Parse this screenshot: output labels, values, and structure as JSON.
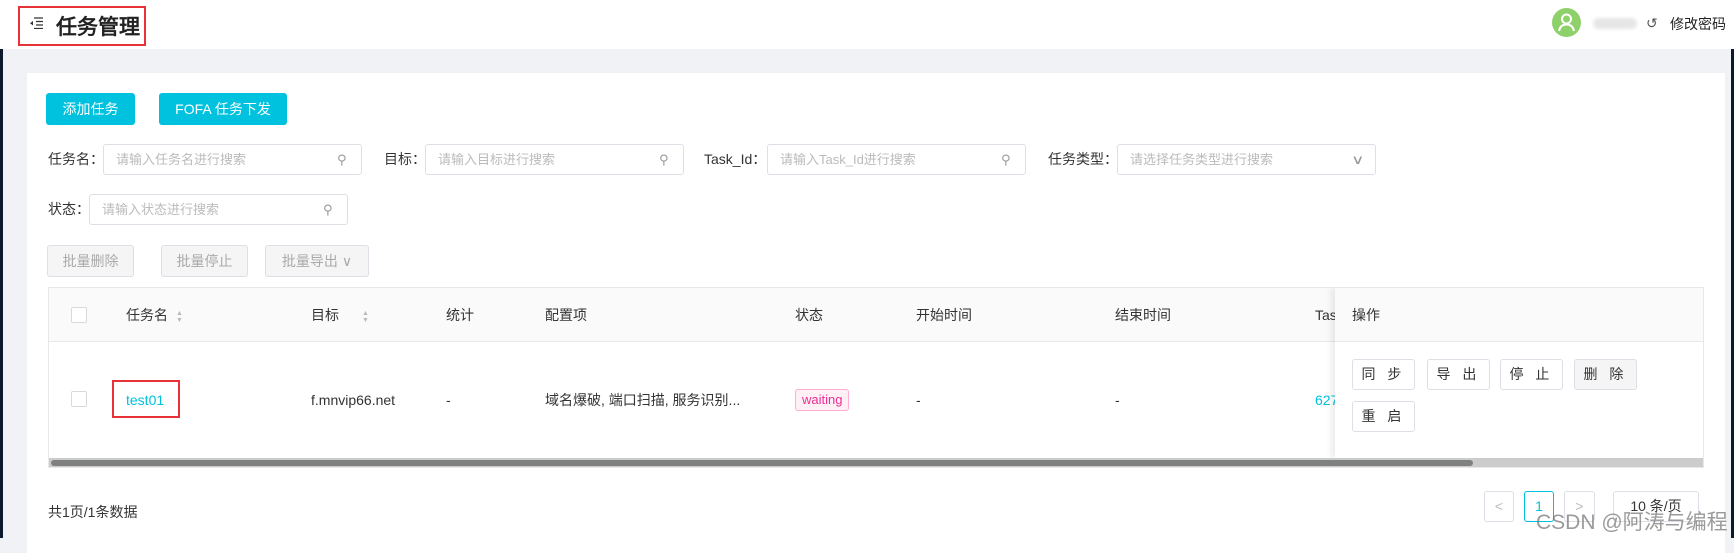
{
  "header": {
    "title": "任务管理",
    "menu_icon": "menu-fold-icon",
    "avatar_icon": "user-icon",
    "logout_icon": "logout-icon",
    "change_password": "修改密码"
  },
  "toolbar": {
    "add_task": "添加任务",
    "fofa_task": "FOFA 任务下发"
  },
  "filters": {
    "task_name": {
      "label": "任务名：",
      "placeholder": "请输入任务名进行搜索"
    },
    "target": {
      "label": "目标：",
      "placeholder": "请输入目标进行搜索"
    },
    "task_id": {
      "label": "Task_Id：",
      "placeholder": "请输入Task_Id进行搜索"
    },
    "task_type": {
      "label": "任务类型：",
      "placeholder": "请选择任务类型进行搜索"
    },
    "status": {
      "label": "状态：",
      "placeholder": "请输入状态进行搜索"
    }
  },
  "batch": {
    "delete": "批量删除",
    "stop": "批量停止",
    "export": "批量导出"
  },
  "table": {
    "columns": [
      "任务名",
      "目标",
      "统计",
      "配置项",
      "状态",
      "开始时间",
      "结束时间",
      "Tas",
      "操作"
    ],
    "rows": [
      {
        "name": "test01",
        "target": "f.mnvip66.net",
        "stats": "-",
        "config": "域名爆破, 端口扫描, 服务识别...",
        "status": "waiting",
        "start": "-",
        "end": "-",
        "task_id": "627"
      }
    ],
    "actions": [
      "同 步",
      "导 出",
      "停 止",
      "删 除",
      "重 启"
    ]
  },
  "footer": {
    "summary": "共1页/1条数据",
    "page": "1",
    "prev": "<",
    "next": ">",
    "page_size": "10 条/页"
  },
  "watermark": "CSDN @阿涛与编程",
  "colors": {
    "accent": "#00c1de",
    "status_waiting": "#eb2f96",
    "highlight_box": "#e8323a"
  }
}
